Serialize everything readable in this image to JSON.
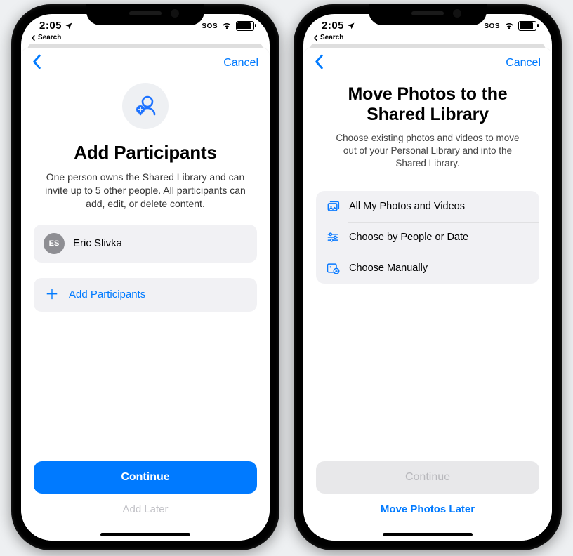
{
  "status": {
    "time": "2:05",
    "sos": "SOS",
    "back_crumb": "Search"
  },
  "phoneA": {
    "cancel": "Cancel",
    "title": "Add Participants",
    "subtitle": "One person owns the Shared Library and can invite up to 5 other people. All participants can add, edit, or delete content.",
    "participant": {
      "initials": "ES",
      "name": "Eric Slivka"
    },
    "add_row": "Add Participants",
    "primary": "Continue",
    "secondary": "Add Later"
  },
  "phoneB": {
    "cancel": "Cancel",
    "title": "Move Photos to the Shared Library",
    "subtitle": "Choose existing photos and videos to move out of your Personal Library and into the Shared Library.",
    "options": [
      "All My Photos and Videos",
      "Choose by People or Date",
      "Choose Manually"
    ],
    "primary": "Continue",
    "secondary": "Move Photos Later"
  }
}
